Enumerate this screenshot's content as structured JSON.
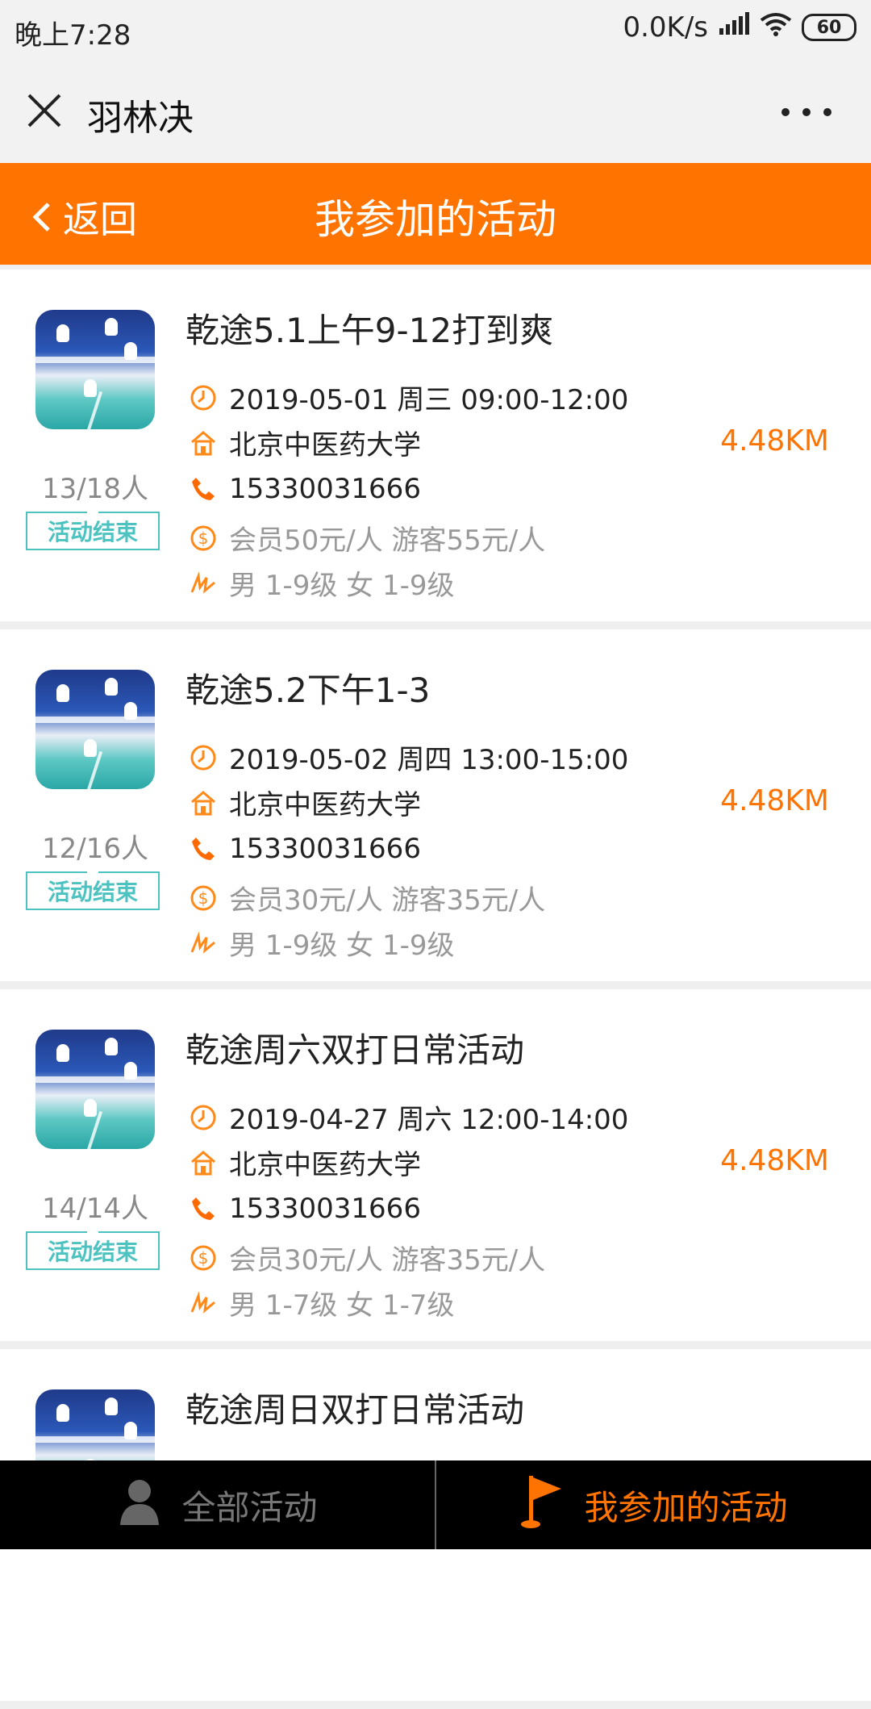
{
  "status_bar": {
    "time": "晚上7:28",
    "network": "0.0K/s",
    "battery": "60"
  },
  "title_bar": {
    "title": "羽林决"
  },
  "header": {
    "back_label": "返回",
    "title": "我参加的活动"
  },
  "activities": [
    {
      "name": "乾途5.1上午9-12打到爽",
      "datetime": "2019-05-01 周三 09:00-12:00",
      "venue": "北京中医药大学",
      "distance": "4.48KM",
      "phone": "15330031666",
      "price": "会员50元/人 游客55元/人",
      "level": "男 1-9级 女 1-9级",
      "count": "13/18人",
      "status": "活动结束"
    },
    {
      "name": "乾途5.2下午1-3",
      "datetime": "2019-05-02 周四 13:00-15:00",
      "venue": "北京中医药大学",
      "distance": "4.48KM",
      "phone": "15330031666",
      "price": "会员30元/人 游客35元/人",
      "level": "男 1-9级 女 1-9级",
      "count": "12/16人",
      "status": "活动结束"
    },
    {
      "name": "乾途周六双打日常活动",
      "datetime": "2019-04-27 周六 12:00-14:00",
      "venue": "北京中医药大学",
      "distance": "4.48KM",
      "phone": "15330031666",
      "price": "会员30元/人 游客35元/人",
      "level": "男 1-7级 女 1-7级",
      "count": "14/14人",
      "status": "活动结束"
    },
    {
      "name": "乾途周日双打日常活动"
    }
  ],
  "bottom_nav": [
    {
      "label": "全部活动",
      "icon": "person-icon",
      "active": false
    },
    {
      "label": "我参加的活动",
      "icon": "flag-icon",
      "active": true
    }
  ],
  "colors": {
    "accent": "#ff7300",
    "badge": "#4cc3c0",
    "nav_bg": "#000000"
  }
}
